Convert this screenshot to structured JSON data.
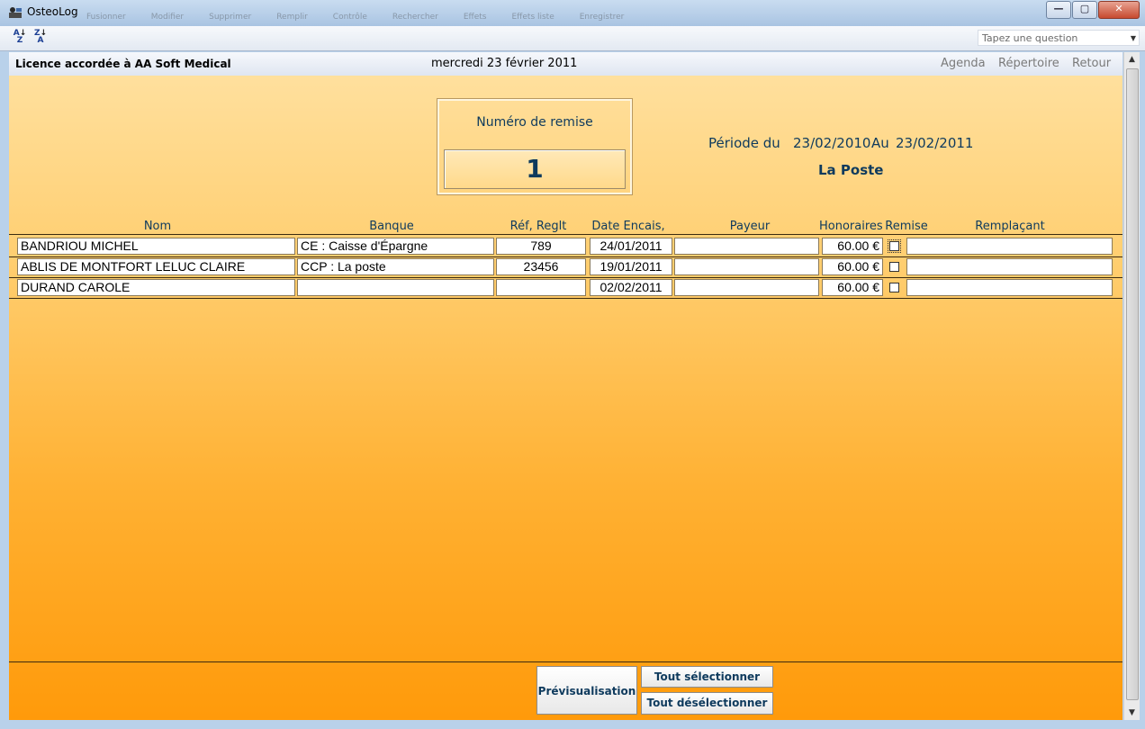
{
  "window": {
    "title": "OsteoLog",
    "ghost_toolbar": [
      "Fusionner",
      "Modifier",
      "Supprimer",
      "Remplir",
      "Contrôle",
      "Rechercher",
      "Effets",
      "Effets liste",
      "Enregistrer"
    ],
    "controls": {
      "minimize": "—",
      "maximize": "▢",
      "close": "✕"
    }
  },
  "toolbar": {
    "sort_asc": {
      "top": "A",
      "bottom": "Z"
    },
    "sort_desc": {
      "top": "Z",
      "bottom": "A"
    },
    "ask_placeholder": "Tapez une question"
  },
  "header": {
    "licence": "Licence accordée à AA Soft Medical",
    "date": "mercredi 23 février 2011",
    "links": [
      "Agenda",
      "Répertoire",
      "Retour"
    ]
  },
  "remise": {
    "label": "Numéro de remise",
    "number": "1"
  },
  "periode": {
    "label": "Période du",
    "from": "23/02/2010",
    "au": "Au",
    "to": "23/02/2011",
    "payeur": "La Poste"
  },
  "columns": {
    "nom": "Nom",
    "banque": "Banque",
    "ref": "Réf, Reglt",
    "date": "Date Encais,",
    "payeur": "Payeur",
    "honoraires": "Honoraires",
    "remise": "Remise",
    "remplacant": "Remplaçant"
  },
  "rows": [
    {
      "nom": "BANDRIOU MICHEL",
      "banque": "CE : Caisse d'Épargne",
      "ref": "789",
      "date": "24/01/2011",
      "payeur": "",
      "honoraires": "60.00 €",
      "remise": false,
      "remplacant": ""
    },
    {
      "nom": "ABLIS DE MONTFORT LELUC CLAIRE",
      "banque": "CCP : La poste",
      "ref": "23456",
      "date": "19/01/2011",
      "payeur": "",
      "honoraires": "60.00 €",
      "remise": false,
      "remplacant": ""
    },
    {
      "nom": "DURAND CAROLE",
      "banque": "",
      "ref": "",
      "date": "02/02/2011",
      "payeur": "",
      "honoraires": "60.00 €",
      "remise": false,
      "remplacant": ""
    }
  ],
  "buttons": {
    "preview": "Prévisualisation",
    "select_all": "Tout sélectionner",
    "deselect_all": "Tout désélectionner"
  },
  "colors": {
    "title_text": "#0e3a5d",
    "gradient_top": "#ffe2a3",
    "gradient_bottom": "#ff9a0a"
  }
}
